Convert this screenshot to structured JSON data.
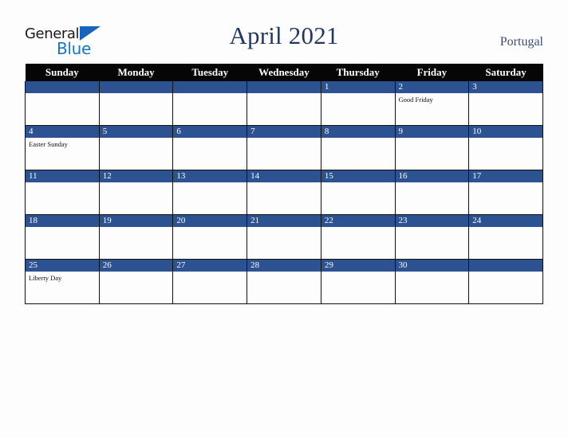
{
  "brand": {
    "name_part1": "General",
    "name_part2": "Blue",
    "triangle_icon": "triangle-icon",
    "color_black": "#1a1a1a",
    "color_blue": "#1577c4"
  },
  "header": {
    "title": "April 2021",
    "country": "Portugal",
    "title_color": "#24375e",
    "country_color": "#3c4f74"
  },
  "calendar": {
    "weekday_headers": [
      "Sunday",
      "Monday",
      "Tuesday",
      "Wednesday",
      "Thursday",
      "Friday",
      "Saturday"
    ],
    "header_bg": "#060606",
    "header_text_color": "#ffffff",
    "daynum_band_bg": "#2d5291",
    "daynum_text_color": "#ffffff",
    "cell_bg": "#fdfdfd",
    "border_color": "#101010",
    "weeks": [
      [
        {
          "day": "",
          "holiday": ""
        },
        {
          "day": "",
          "holiday": ""
        },
        {
          "day": "",
          "holiday": ""
        },
        {
          "day": "",
          "holiday": ""
        },
        {
          "day": "1",
          "holiday": ""
        },
        {
          "day": "2",
          "holiday": "Good Friday"
        },
        {
          "day": "3",
          "holiday": ""
        }
      ],
      [
        {
          "day": "4",
          "holiday": "Easter Sunday"
        },
        {
          "day": "5",
          "holiday": ""
        },
        {
          "day": "6",
          "holiday": ""
        },
        {
          "day": "7",
          "holiday": ""
        },
        {
          "day": "8",
          "holiday": ""
        },
        {
          "day": "9",
          "holiday": ""
        },
        {
          "day": "10",
          "holiday": ""
        }
      ],
      [
        {
          "day": "11",
          "holiday": ""
        },
        {
          "day": "12",
          "holiday": ""
        },
        {
          "day": "13",
          "holiday": ""
        },
        {
          "day": "14",
          "holiday": ""
        },
        {
          "day": "15",
          "holiday": ""
        },
        {
          "day": "16",
          "holiday": ""
        },
        {
          "day": "17",
          "holiday": ""
        }
      ],
      [
        {
          "day": "18",
          "holiday": ""
        },
        {
          "day": "19",
          "holiday": ""
        },
        {
          "day": "20",
          "holiday": ""
        },
        {
          "day": "21",
          "holiday": ""
        },
        {
          "day": "22",
          "holiday": ""
        },
        {
          "day": "23",
          "holiday": ""
        },
        {
          "day": "24",
          "holiday": ""
        }
      ],
      [
        {
          "day": "25",
          "holiday": "Liberty Day"
        },
        {
          "day": "26",
          "holiday": ""
        },
        {
          "day": "27",
          "holiday": ""
        },
        {
          "day": "28",
          "holiday": ""
        },
        {
          "day": "29",
          "holiday": ""
        },
        {
          "day": "30",
          "holiday": ""
        },
        {
          "day": "",
          "holiday": ""
        }
      ]
    ]
  }
}
